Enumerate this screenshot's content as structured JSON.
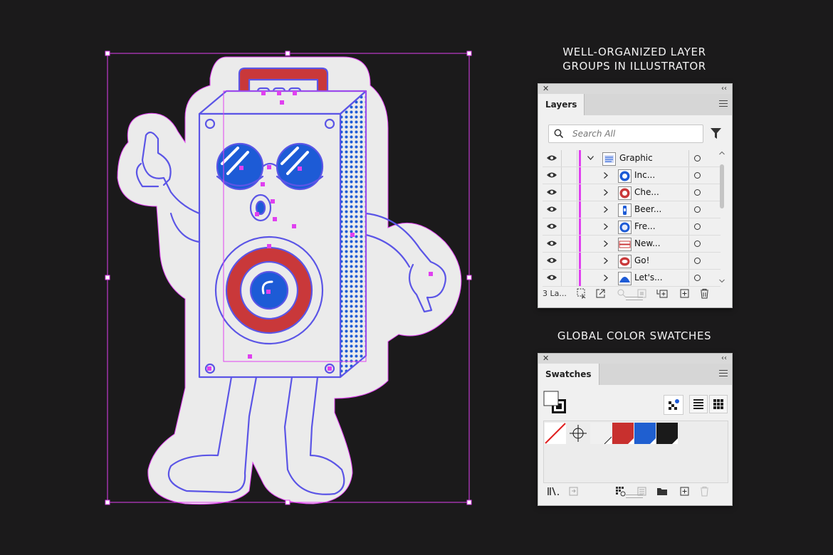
{
  "captions": {
    "layers_heading_line1": "WELL-ORGANIZED LAYER",
    "layers_heading_line2": "GROUPS IN ILLUSTRATOR",
    "swatches_heading": "GLOBAL COLOR SWATCHES"
  },
  "layers_panel": {
    "tab_label": "Layers",
    "search_placeholder": "Search All",
    "rows": [
      {
        "label": "Graphic",
        "level": 0,
        "expanded": true,
        "icon": "graphic-thumb-icon"
      },
      {
        "label": "Inc...",
        "level": 1,
        "expanded": false,
        "icon": "sticker-thumb-icon"
      },
      {
        "label": "Che...",
        "level": 1,
        "expanded": false,
        "icon": "sticker-thumb-icon"
      },
      {
        "label": "Beer...",
        "level": 1,
        "expanded": false,
        "icon": "sticker-thumb-icon"
      },
      {
        "label": "Fre...",
        "level": 1,
        "expanded": false,
        "icon": "sticker-thumb-icon"
      },
      {
        "label": "New...",
        "level": 1,
        "expanded": false,
        "icon": "sticker-thumb-icon"
      },
      {
        "label": "Go!",
        "level": 1,
        "expanded": false,
        "icon": "sticker-thumb-icon"
      },
      {
        "label": "Let's...",
        "level": 1,
        "expanded": false,
        "icon": "sticker-thumb-icon"
      }
    ],
    "footer_count": "3 La..."
  },
  "swatches_panel": {
    "tab_label": "Swatches",
    "swatches": [
      {
        "name": "None",
        "color": "#ffffff"
      },
      {
        "name": "Registration",
        "color": "#000000"
      },
      {
        "name": "White",
        "color": "#f0f0f0"
      },
      {
        "name": "Red",
        "color": "#c8302e"
      },
      {
        "name": "Blue",
        "color": "#1f5fd0"
      },
      {
        "name": "Black",
        "color": "#1a1a1a"
      }
    ]
  },
  "artwork": {
    "colors": {
      "outline": "#5b55e6",
      "red": "#c9383a",
      "blue": "#1d5bd6",
      "body": "#ebebeb",
      "selection": "#e040f0"
    }
  }
}
